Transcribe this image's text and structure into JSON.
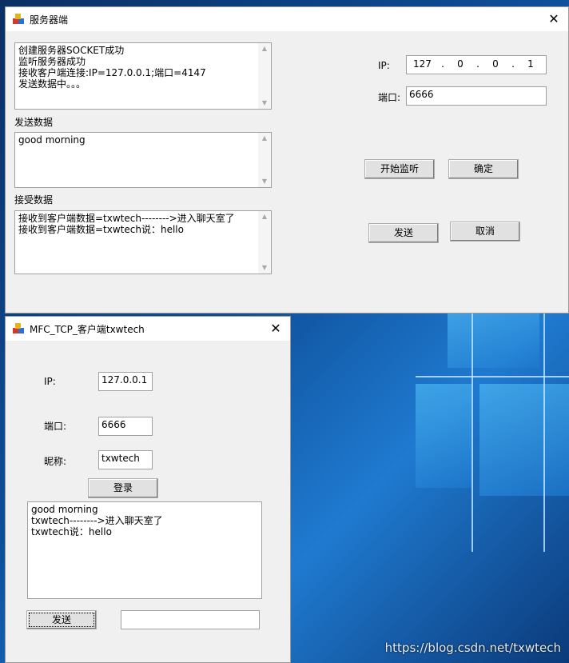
{
  "server": {
    "title": "服务器端",
    "close": "✕",
    "log_lines": [
      "创建服务器SOCKET成功",
      "监听服务器成功",
      "接收客户端连接:IP=127.0.0.1;端口=4147",
      "发送数据中。。。"
    ],
    "send_label": "发送数据",
    "send_text": "good morning",
    "recv_label": "接受数据",
    "recv_lines": [
      "接收到客户端数据=txwtech-------->进入聊天室了",
      "接收到客户端数据=txwtech说：hello"
    ],
    "ip_label": "IP:",
    "ip_octets": [
      "127",
      "0",
      "0",
      "1"
    ],
    "port_label": "端口:",
    "port_value": "6666",
    "btn_listen": "开始监听",
    "btn_ok": "确定",
    "btn_send": "发送",
    "btn_cancel": "取消"
  },
  "client": {
    "title": "MFC_TCP_客户端txwtech",
    "close": "✕",
    "ip_label": "IP:",
    "ip_value": "127.0.0.1",
    "port_label": "端口:",
    "port_value": "6666",
    "nick_label": "昵称:",
    "nick_value": "txwtech",
    "btn_login": "登录",
    "chat_lines": [
      "good morning",
      "txwtech-------->进入聊天室了",
      "txwtech说：hello"
    ],
    "btn_send": "发送",
    "send_value": ""
  },
  "watermark": "https://blog.csdn.net/txwtech"
}
